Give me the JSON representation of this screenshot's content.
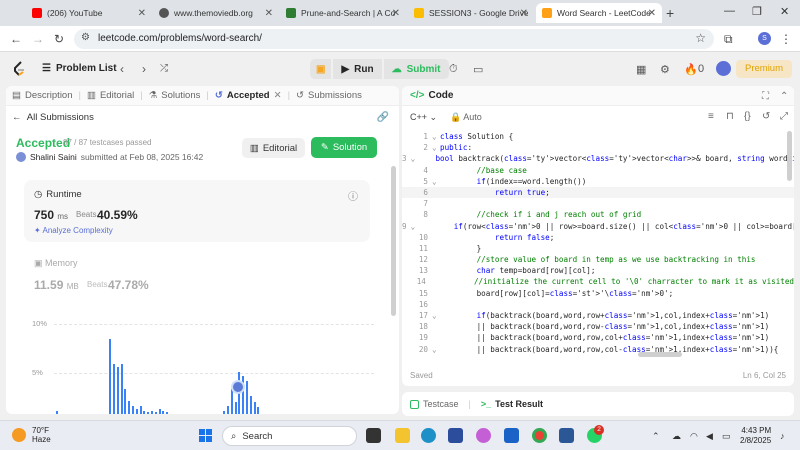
{
  "browser": {
    "tabs": [
      {
        "title": "(206) YouTube",
        "color": "#ff0000"
      },
      {
        "title": "www.themoviedb.org",
        "color": "#555555"
      },
      {
        "title": "Prune-and-Search | A Co",
        "color": "#2e7d32"
      },
      {
        "title": "SESSION3 - Google Drive",
        "color": "#fbbc04"
      },
      {
        "title": "Word Search - LeetCode",
        "color": "#ffa116"
      }
    ],
    "new_tab": "+",
    "url": "leetcode.com/problems/word-search/",
    "profile_initial": "S"
  },
  "nav": {
    "problem_list": "Problem List",
    "run": "Run",
    "submit": "Submit",
    "streak": "0",
    "premium": "Premium"
  },
  "left": {
    "tabs": [
      {
        "label": "Description",
        "active": false
      },
      {
        "label": "Editorial",
        "active": false
      },
      {
        "label": "Solutions",
        "active": false
      },
      {
        "label": "Accepted",
        "active": true
      },
      {
        "label": "Submissions",
        "active": false
      }
    ],
    "all_submissions": "All Submissions",
    "status": "Accepted",
    "testcases": "87 / 87 testcases passed",
    "user": "Shalini Saini",
    "submitted": "submitted at Feb 08, 2025 16:42",
    "editorial_btn": "Editorial",
    "solution_btn": "Solution",
    "runtime": {
      "title": "Runtime",
      "value": "750",
      "unit": "ms",
      "beats_label": "Beats",
      "beats": "40.59%",
      "analyze": "Analyze Complexity"
    },
    "memory": {
      "title": "Memory",
      "value": "11.59",
      "unit": "MB",
      "beats_label": "Beats",
      "beats": "47.78%"
    },
    "chart_y_labels": [
      "10%",
      "5%"
    ]
  },
  "chart_data": {
    "type": "bar",
    "ylim": [
      0,
      12
    ],
    "y_ticks": [
      "10%",
      "5%"
    ],
    "values": [
      0.4,
      0,
      0,
      0,
      0,
      0,
      0,
      0,
      0,
      0,
      0,
      0,
      0,
      0,
      9.0,
      6.0,
      5.6,
      6.0,
      3.0,
      1.6,
      1.0,
      0.6,
      1.0,
      0.4,
      0.2,
      0.4,
      0.2,
      0.6,
      0.4,
      0.2,
      0,
      0,
      0,
      0,
      0,
      0,
      0,
      0,
      0,
      0,
      0,
      0,
      0,
      0,
      0.4,
      1.0,
      3.0,
      1.4,
      5.0,
      4.6,
      4.0,
      2.2,
      1.4,
      0.8
    ],
    "highlight_index": 48
  },
  "editor": {
    "title": "Code",
    "language": "C++",
    "mode": "Auto",
    "saved": "Saved",
    "cursor": "Ln 6, Col 25",
    "lines": [
      "class Solution {",
      "public:",
      "    bool backtrack(vector<vector<char>>& board, string word,int row,int col,int",
      "        //base case",
      "        if(index==word.length())",
      "            return true;",
      "",
      "        //check if i and j reach out of grid",
      "        if(row<0 || row>=board.size() || col<0 || col>=board[0].size() || board[",
      "            return false;",
      "        }",
      "        //store value of board in temp as we use backtracking in this",
      "        char temp=board[row][col];",
      "        //initialize the current cell to '\\0' charracter to mark it as visited",
      "        board[row][col]='\\0';",
      "",
      "        if(backtrack(board,word,row+1,col,index+1)",
      "        || backtrack(board,word,row-1,col,index+1)",
      "        || backtrack(board,word,row,col+1,index+1)",
      "        || backtrack(board,word,row,col-1,index+1)){"
    ]
  },
  "bottom": {
    "testcase": "Testcase",
    "test_result": "Test Result"
  },
  "taskbar": {
    "temp": "70°F",
    "weather": "Haze",
    "search": "Search",
    "time": "4:43 PM",
    "date": "2/8/2025",
    "badge": "2"
  }
}
